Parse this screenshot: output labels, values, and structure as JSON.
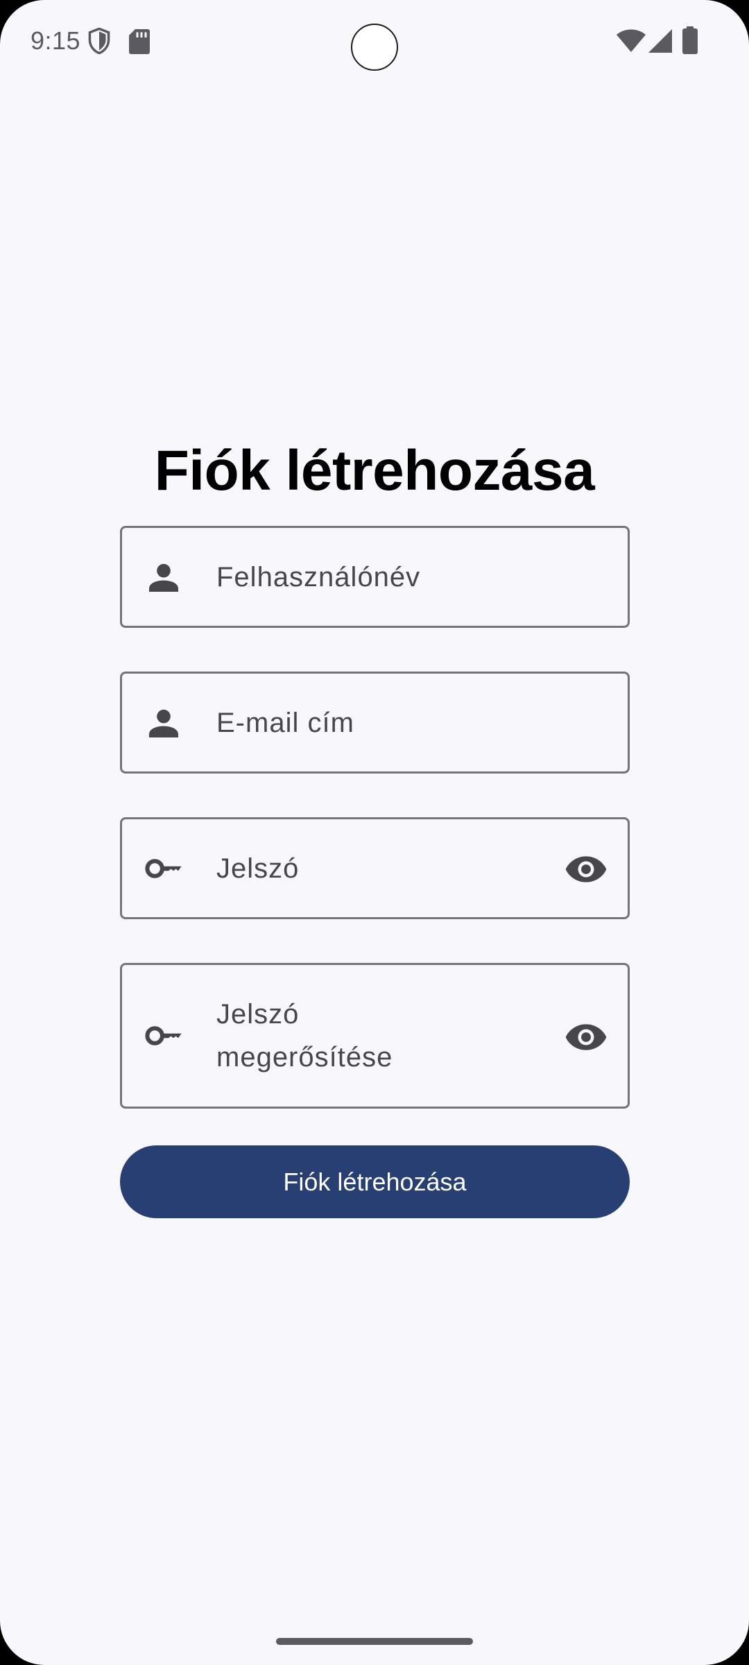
{
  "status_bar": {
    "time": "9:15",
    "icons": [
      "shield-icon",
      "sd-card-icon",
      "wifi-icon",
      "cellular-signal-icon",
      "battery-icon"
    ]
  },
  "page": {
    "title": "Fiók létrehozása"
  },
  "form": {
    "username": {
      "placeholder": "Felhasználónév",
      "icon": "person-icon"
    },
    "email": {
      "placeholder": "E-mail cím",
      "icon": "person-icon"
    },
    "password": {
      "placeholder": "Jelszó",
      "icon": "key-icon",
      "toggle_icon": "eye-icon"
    },
    "confirm_password": {
      "placeholder_line1": "Jelszó",
      "placeholder_line2": "megerősítése",
      "icon": "key-icon",
      "toggle_icon": "eye-icon"
    },
    "submit_label": "Fiók létrehozása"
  },
  "colors": {
    "background": "#f8f7fc",
    "button": "#283f74",
    "button_text": "#ffffff",
    "field_border": "#737378",
    "icon": "#46464c"
  }
}
